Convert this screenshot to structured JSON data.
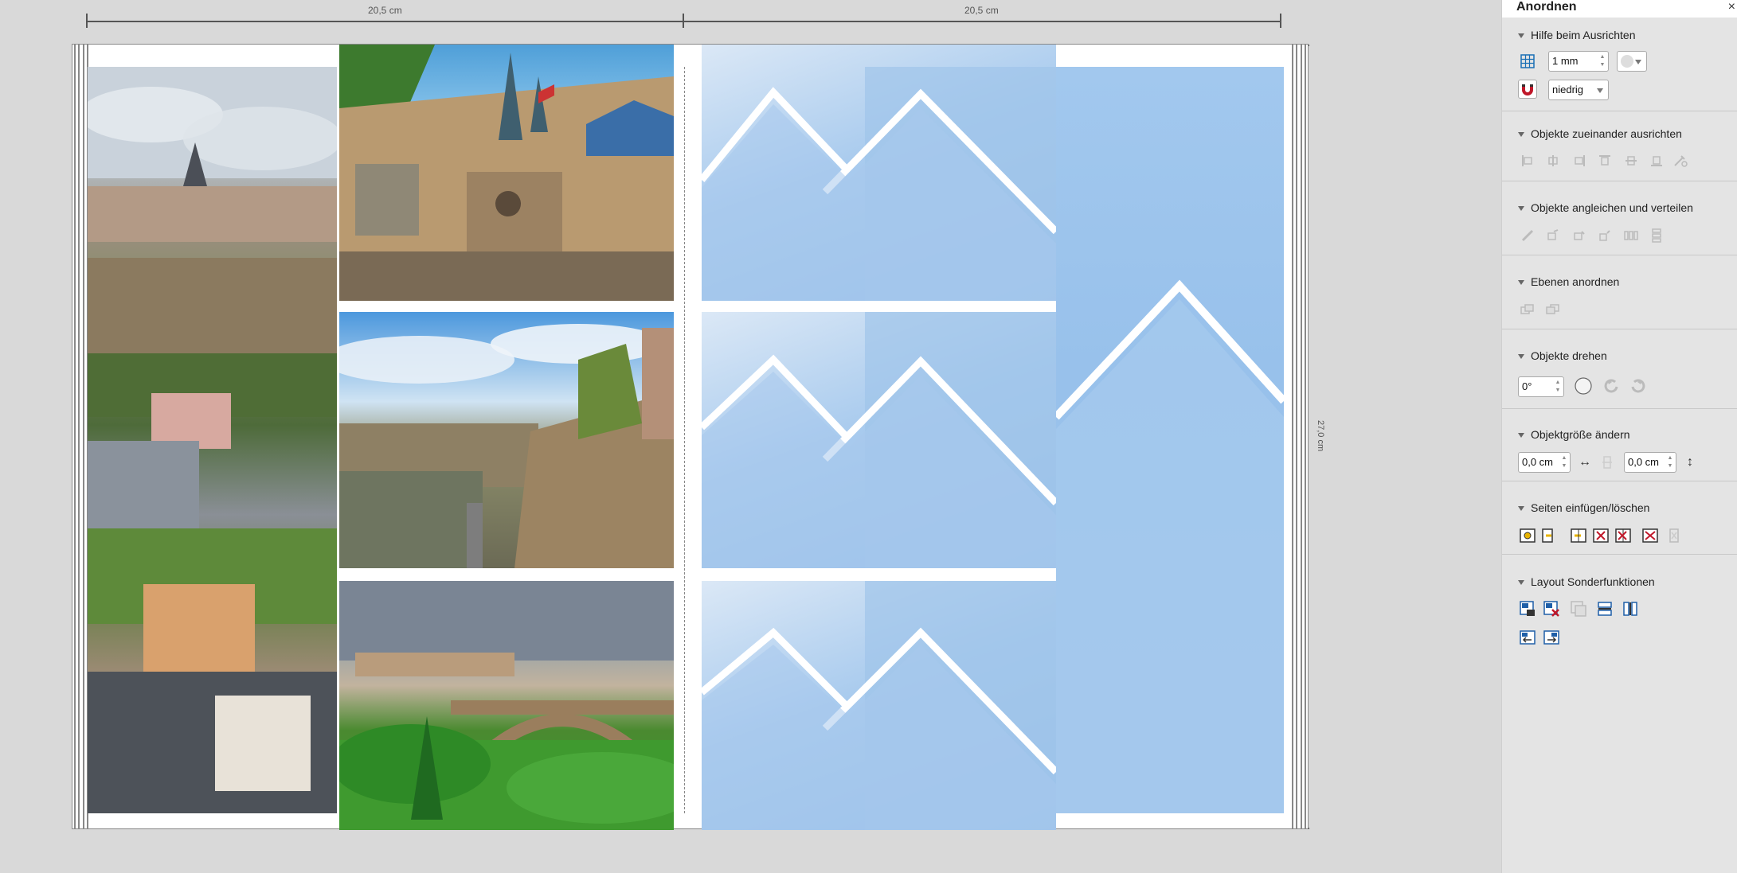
{
  "ruler": {
    "left_width": "20,5 cm",
    "right_width": "20,5 cm",
    "height": "27,0 cm"
  },
  "panel": {
    "title": "Anordnen",
    "close_label": "×",
    "sections": {
      "align_help": {
        "title": "Hilfe beim Ausrichten",
        "grid_value": "1 mm",
        "snap_value": "niedrig"
      },
      "align_objects": {
        "title": "Objekte zueinander ausrichten"
      },
      "match_distribute": {
        "title": "Objekte angleichen und verteilen"
      },
      "layers": {
        "title": "Ebenen anordnen"
      },
      "rotate": {
        "title": "Objekte drehen",
        "angle_value": "0°"
      },
      "resize": {
        "title": "Objektgröße ändern",
        "width_value": "0,0 cm",
        "height_value": "0,0 cm"
      },
      "pages": {
        "title": "Seiten einfügen/löschen"
      },
      "layout_special": {
        "title": "Layout Sonderfunktionen"
      }
    }
  },
  "colors": {
    "accent_red": "#c0182a",
    "accent_blue": "#1f5fa8",
    "placeholder_blue": "#a9cbee"
  }
}
